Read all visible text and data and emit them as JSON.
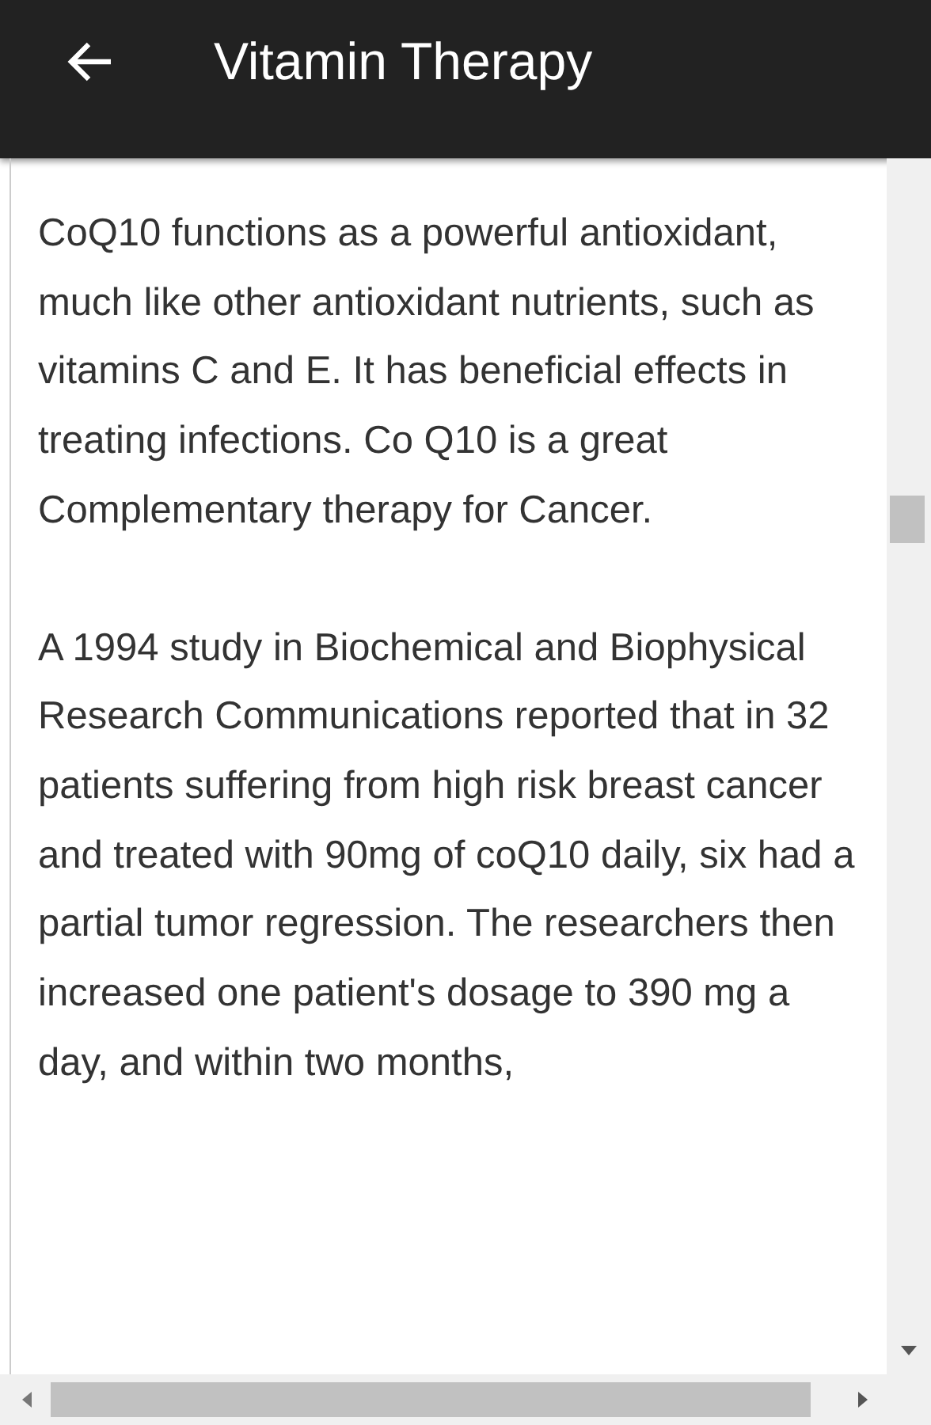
{
  "app_bar": {
    "title": "Vitamin Therapy"
  },
  "content": {
    "paragraphs": [
      "CoQ10 functions as a powerful antioxidant, much like other antioxidant nutrients, such as vitamins C and E. It has beneficial effects in treating infections. Co Q10 is a great Complementary therapy for Cancer.",
      "A 1994 study in Biochemical and Biophysical Research Communications reported that in 32 patients suffering from high risk breast cancer and treated with 90mg of coQ10 daily, six had a partial tumor regression. The researchers then increased one patient's dosage to 390 mg a day, and within two months,"
    ]
  }
}
